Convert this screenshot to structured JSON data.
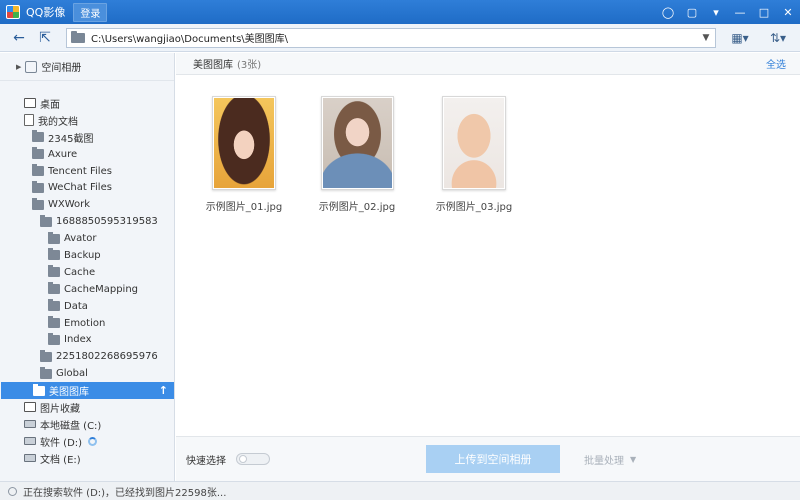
{
  "titlebar": {
    "app_title": "QQ影像",
    "login_label": "登录",
    "controls": [
      "feedback-icon",
      "skin-icon",
      "menu-icon",
      "minimize-icon",
      "maximize-icon",
      "close-icon"
    ]
  },
  "addressbar": {
    "path": "C:\\Users\\wangjiao\\Documents\\美图图库\\"
  },
  "sidebar": {
    "cloud_album": "空间相册",
    "tree": [
      {
        "label": "桌面",
        "icon": "desktop-icon",
        "level": 0
      },
      {
        "label": "我的文档",
        "icon": "document-icon",
        "level": 0
      },
      {
        "label": "2345截图",
        "icon": "folder-icon",
        "level": 1
      },
      {
        "label": "Axure",
        "icon": "folder-icon",
        "level": 1
      },
      {
        "label": "Tencent Files",
        "icon": "folder-icon",
        "level": 1
      },
      {
        "label": "WeChat Files",
        "icon": "folder-icon",
        "level": 1
      },
      {
        "label": "WXWork",
        "icon": "folder-icon",
        "level": 1
      },
      {
        "label": "1688850595319583",
        "icon": "folder-icon",
        "level": 2
      },
      {
        "label": "Avator",
        "icon": "folder-icon",
        "level": 3
      },
      {
        "label": "Backup",
        "icon": "folder-icon",
        "level": 3
      },
      {
        "label": "Cache",
        "icon": "folder-icon",
        "level": 3
      },
      {
        "label": "CacheMapping",
        "icon": "folder-icon",
        "level": 3
      },
      {
        "label": "Data",
        "icon": "folder-icon",
        "level": 3
      },
      {
        "label": "Emotion",
        "icon": "folder-icon",
        "level": 3
      },
      {
        "label": "Index",
        "icon": "folder-icon",
        "level": 3
      },
      {
        "label": "2251802268695976",
        "icon": "folder-icon",
        "level": 2
      },
      {
        "label": "Global",
        "icon": "folder-icon",
        "level": 2
      },
      {
        "label": "美图图库",
        "icon": "folder-icon",
        "level": 1,
        "selected": true
      },
      {
        "label": "图片收藏",
        "icon": "photo-icon",
        "level": 0
      },
      {
        "label": "本地磁盘 (C:)",
        "icon": "drive-icon",
        "level": 0
      },
      {
        "label": "软件 (D:)",
        "icon": "drive-icon",
        "level": 0,
        "loading": true
      },
      {
        "label": "文档 (E:)",
        "icon": "drive-icon",
        "level": 0
      }
    ]
  },
  "main": {
    "gallery_name": "美图图库",
    "gallery_count": "(3张)",
    "select_all": "全选",
    "photos": [
      {
        "name": "示例图片_01.jpg"
      },
      {
        "name": "示例图片_02.jpg"
      },
      {
        "name": "示例图片_03.jpg"
      }
    ]
  },
  "actionbar": {
    "quick_select": "快速选择",
    "upload_label": "上传到空间相册",
    "batch_label": "批量处理"
  },
  "status": {
    "text": "正在搜索软件 (D:)，已经找到图片22598张..."
  },
  "colors": {
    "accent": "#2f7ed8",
    "selected": "#3b8ce6",
    "upload_disabled": "#a9d0f3"
  }
}
